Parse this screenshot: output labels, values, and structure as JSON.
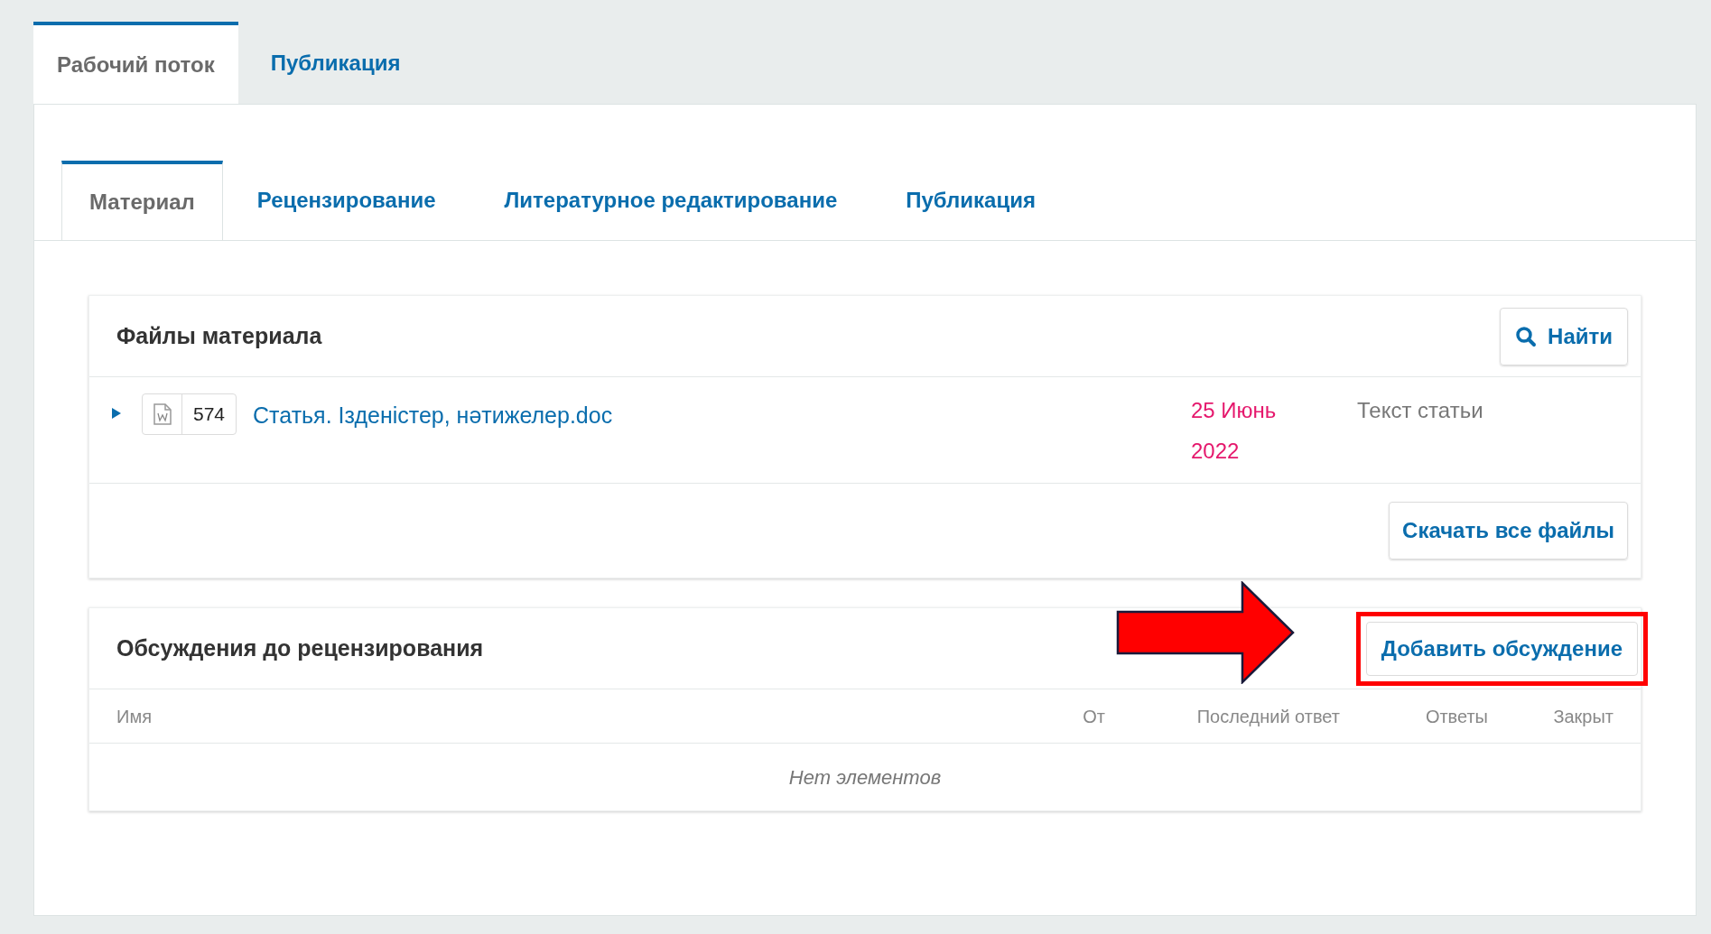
{
  "main_tabs": [
    {
      "label": "Рабочий поток",
      "selected": true
    },
    {
      "label": "Публикация",
      "selected": false
    }
  ],
  "stage_tabs": [
    {
      "label": "Материал",
      "selected": true
    },
    {
      "label": "Рецензирование",
      "selected": false
    },
    {
      "label": "Литературное редактирование",
      "selected": false
    },
    {
      "label": "Публикация",
      "selected": false
    }
  ],
  "files_panel": {
    "title": "Файлы материала",
    "search_button": "Найти",
    "files": [
      {
        "expanded": false,
        "id": "574",
        "name": "Статья. Ізденістер, нәтижелер.doc",
        "date": "25 Июнь 2022",
        "type": "Текст статьи"
      }
    ],
    "download_button": "Скачать все файлы"
  },
  "discussions_panel": {
    "title": "Обсуждения до рецензирования",
    "add_button": "Добавить обсуждение",
    "highlighted": true,
    "columns": [
      "Имя",
      "От",
      "Последний ответ",
      "Ответы",
      "Закрыт"
    ],
    "empty_text": "Нет элементов"
  }
}
